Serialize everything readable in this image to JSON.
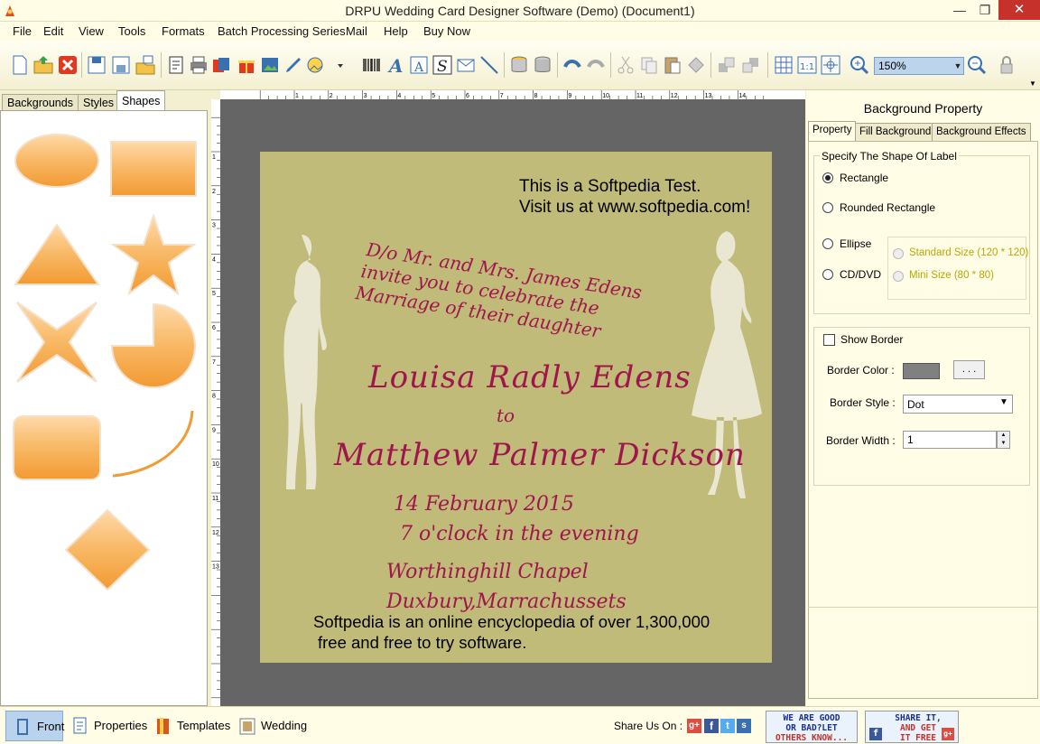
{
  "window": {
    "title": "DRPU Wedding Card Designer Software (Demo) (Document1)"
  },
  "menu": [
    "File",
    "Edit",
    "View",
    "Tools",
    "Formats",
    "Batch Processing Series",
    "Mail",
    "Help",
    "Buy Now"
  ],
  "toolbar": {
    "zoom_value": "150%"
  },
  "left_panel": {
    "tabs": [
      "Backgrounds",
      "Styles",
      "Shapes"
    ],
    "active_tab": "Shapes"
  },
  "ruler": {
    "h_labels": [
      "1",
      "2",
      "3",
      "4",
      "5",
      "6",
      "7",
      "8",
      "9",
      "10",
      "11",
      "12",
      "13",
      "14"
    ],
    "v_labels": [
      "1",
      "2",
      "3",
      "4",
      "5",
      "6",
      "7",
      "8",
      "9",
      "10",
      "11",
      "12",
      "13"
    ]
  },
  "card": {
    "test_line1": "This is a Softpedia Test.",
    "test_line2": "Visit us at www.softpedia.com!",
    "invite_line1": "D/o Mr. and Mrs. James Edens",
    "invite_line2": "invite you to celebrate the",
    "invite_line3": "Marriage of their daughter",
    "bride": "Louisa  Radly  Edens",
    "to": "to",
    "groom": "Matthew  Palmer  Dickson",
    "date": "14 February 2015",
    "time": "7 o'clock in the evening",
    "venue": "Worthinghill Chapel",
    "city": "Duxbury,Marrachussets",
    "footer_line1": "Softpedia is an online encyclopedia of over 1,300,000",
    "footer_line2": "free and free to try software."
  },
  "right_panel": {
    "title": "Background Property",
    "tabs": [
      "Property",
      "Fill Background",
      "Background Effects"
    ],
    "shape_group_title": "Specify The Shape Of Label",
    "shapes": {
      "rectangle": "Rectangle",
      "rounded": "Rounded Rectangle",
      "ellipse": "Ellipse",
      "cd": "CD/DVD"
    },
    "sizes": {
      "standard": "Standard Size (120 * 120)",
      "mini": "Mini Size (80 * 80)"
    },
    "show_border": "Show Border",
    "border_color_label": "Border Color :",
    "border_color": "#808080",
    "border_color_btn": ". . .",
    "border_style_label": "Border Style :",
    "border_style_value": "Dot",
    "border_width_label": "Border Width :",
    "border_width_value": "1"
  },
  "statusbar": {
    "front": "Front",
    "properties": "Properties",
    "templates": "Templates",
    "wedding_details": "Wedding Details",
    "share_label": "Share Us On :",
    "promo1": [
      "WE ARE GOOD",
      "OR BAD?LET",
      "OTHERS KNOW..."
    ],
    "promo2": [
      "SHARE IT,",
      "AND GET",
      "IT FREE"
    ]
  },
  "colors": {
    "accent": "#f6a94a",
    "card": "#c0bb78",
    "script": "#a0154d",
    "canvas": "#656565"
  }
}
